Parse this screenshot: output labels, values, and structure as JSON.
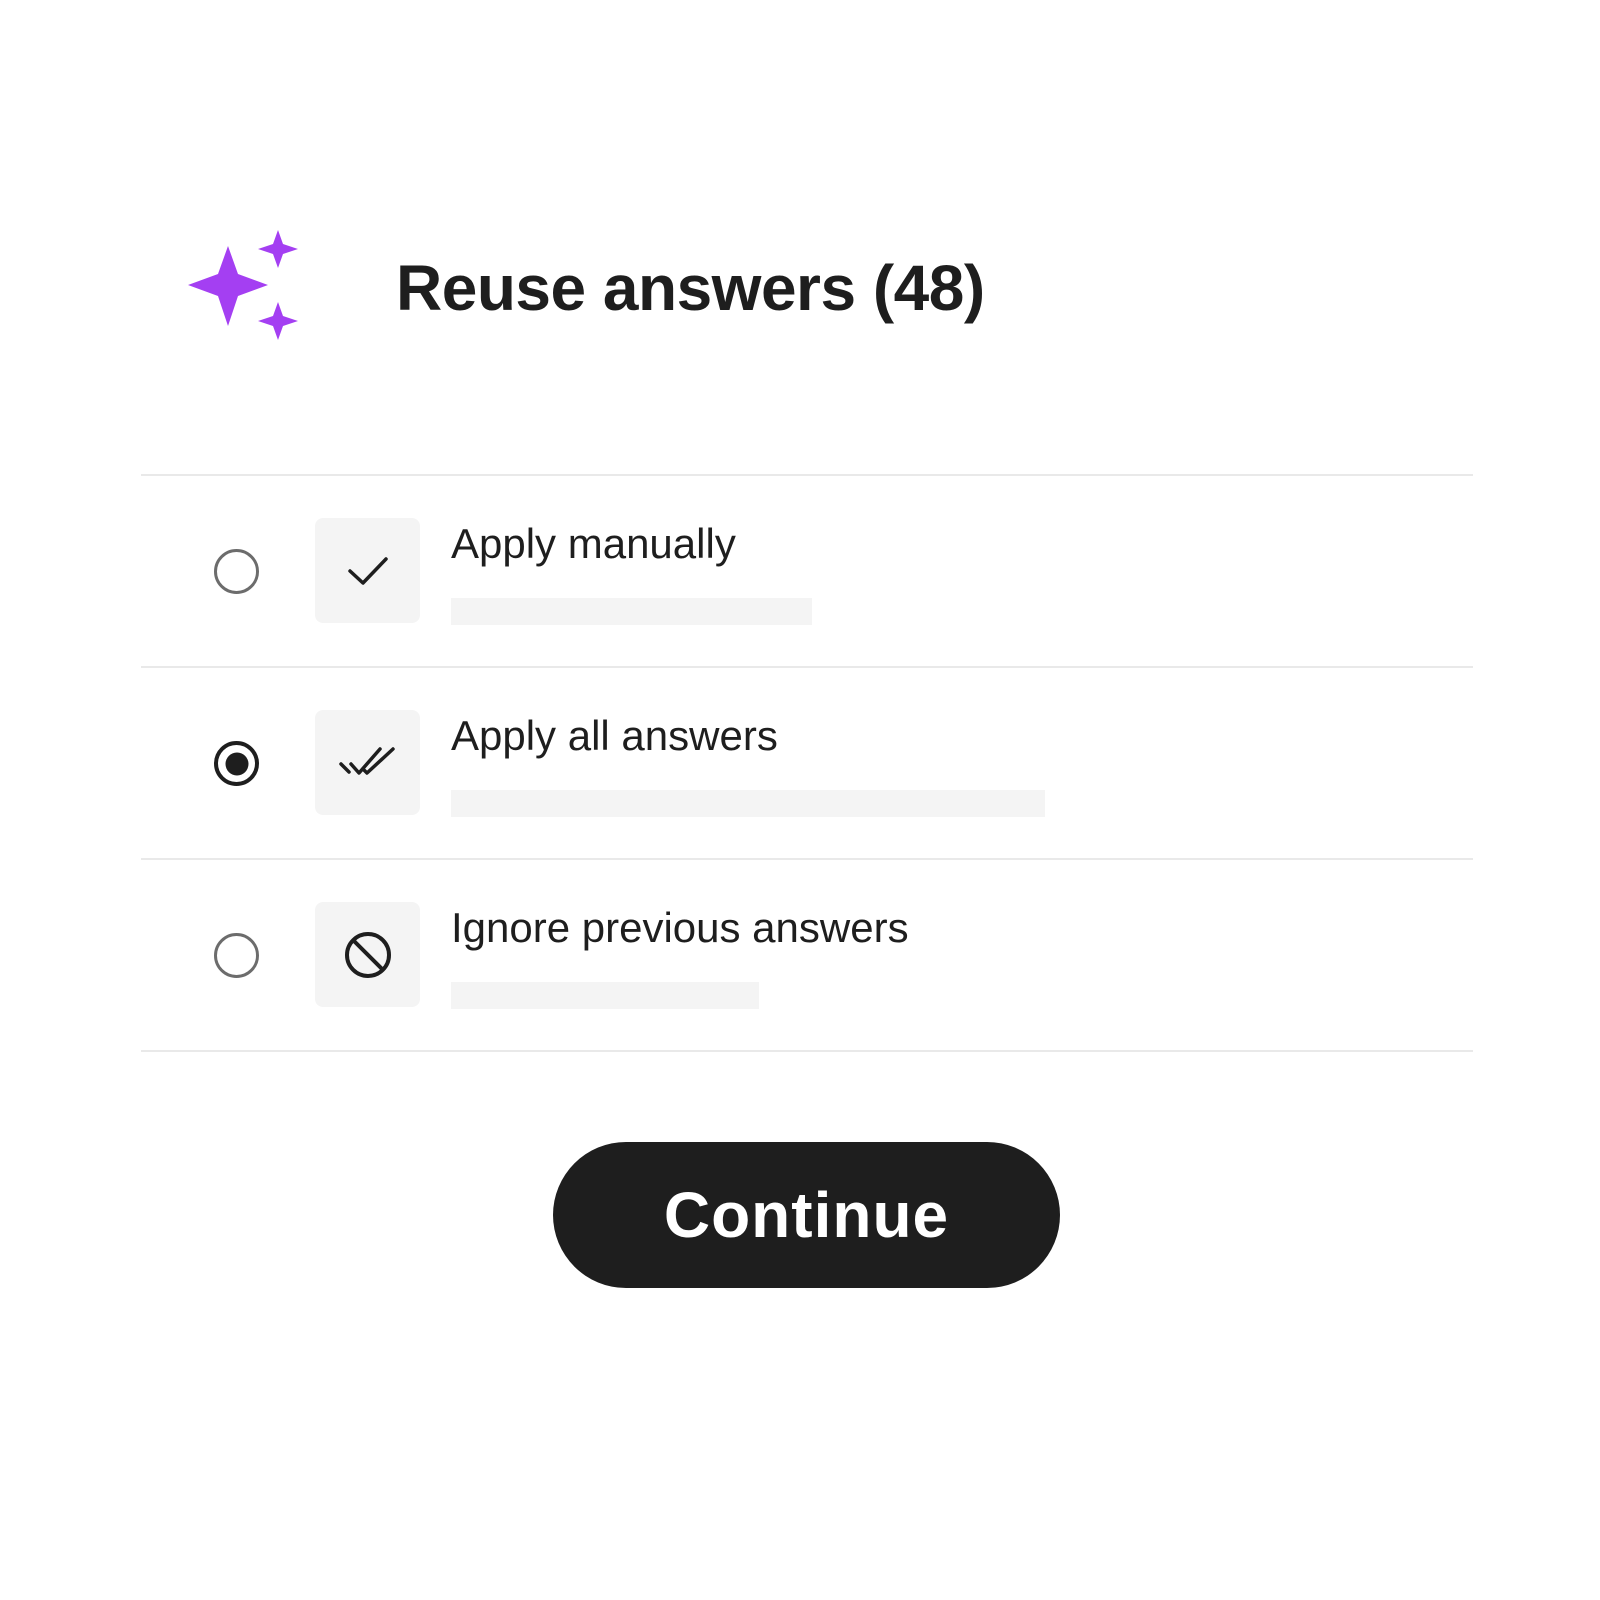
{
  "header": {
    "icon": "sparkles-icon",
    "title": "Reuse answers (48)",
    "accent_color": "#a43ff2"
  },
  "options": [
    {
      "label": "Apply manually",
      "icon": "check-icon",
      "selected": false
    },
    {
      "label": "Apply all answers",
      "icon": "double-check-icon",
      "selected": true
    },
    {
      "label": "Ignore previous answers",
      "icon": "ban-icon",
      "selected": false
    }
  ],
  "continue_label": "Continue",
  "colors": {
    "text": "#1e1e1e",
    "muted_radio": "#6c6c6c",
    "tile_bg": "#f4f4f4",
    "divider": "#e9e9e9",
    "button_bg": "#1e1e1e",
    "button_text": "#ffffff"
  }
}
